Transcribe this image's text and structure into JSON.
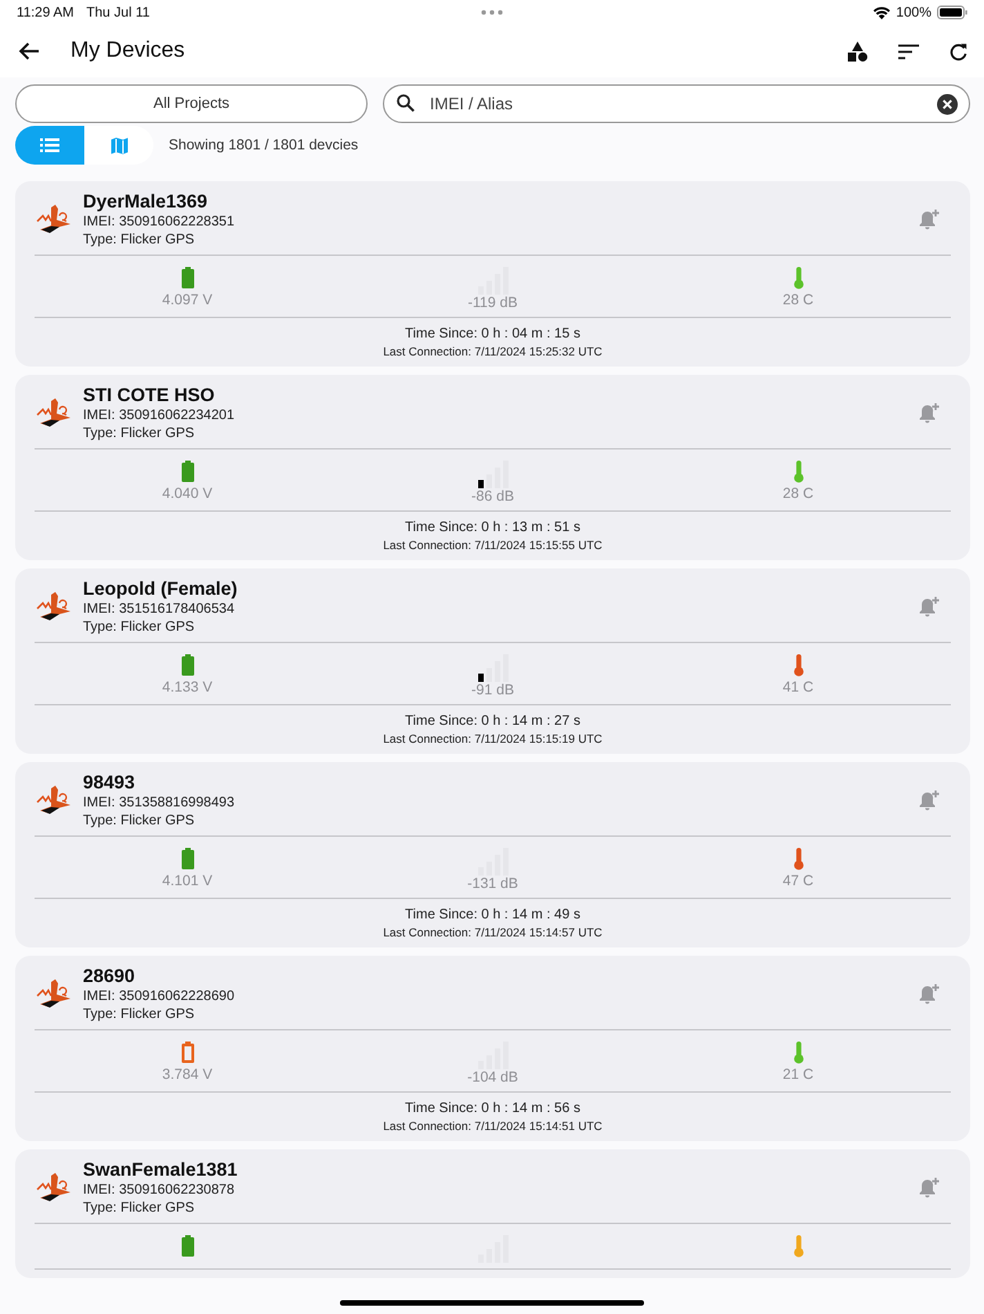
{
  "status_bar": {
    "time": "11:29 AM",
    "date": "Thu Jul 11",
    "battery": "100%"
  },
  "header": {
    "title": "My Devices"
  },
  "filters": {
    "project": "All Projects",
    "search": {
      "placeholder": "IMEI / Alias"
    }
  },
  "view_toggle": [
    {
      "kind": "list",
      "selected": true
    },
    {
      "kind": "map",
      "selected": false
    }
  ],
  "count": "Showing 1801 / 1801 devcies",
  "devices": [
    {
      "name": "DyerMale1369",
      "imei": "IMEI: 350916062228351",
      "type": "Type: Flicker GPS",
      "battery": {
        "reading": "4.097 V",
        "color": "#3a9a1e"
      },
      "signal": {
        "reading": "-119 dB",
        "first_bar_lit": false
      },
      "temperature": {
        "reading": "28 C",
        "color": "#5cc22a"
      },
      "time_since": "Time Since: 0 h : 04 m : 15 s",
      "last_connection": "Last Connection: 7/11/2024 15:25:32 UTC"
    },
    {
      "name": "STI COTE HSO",
      "imei": "IMEI: 350916062234201",
      "type": "Type: Flicker GPS",
      "battery": {
        "reading": "4.040 V",
        "color": "#3a9a1e"
      },
      "signal": {
        "reading": "-86 dB",
        "first_bar_lit": true
      },
      "temperature": {
        "reading": "28 C",
        "color": "#5cc22a"
      },
      "time_since": "Time Since: 0 h : 13 m : 51 s",
      "last_connection": "Last Connection: 7/11/2024 15:15:55 UTC"
    },
    {
      "name": "Leopold (Female)",
      "imei": "IMEI: 351516178406534",
      "type": "Type: Flicker GPS",
      "battery": {
        "reading": "4.133 V",
        "color": "#3a9a1e"
      },
      "signal": {
        "reading": "-91 dB",
        "first_bar_lit": true
      },
      "temperature": {
        "reading": "41 C",
        "color": "#e0521c"
      },
      "time_since": "Time Since: 0 h : 14 m : 27 s",
      "last_connection": "Last Connection: 7/11/2024 15:15:19 UTC"
    },
    {
      "name": "98493",
      "imei": "IMEI: 351358816998493",
      "type": "Type: Flicker GPS",
      "battery": {
        "reading": "4.101 V",
        "color": "#3a9a1e"
      },
      "signal": {
        "reading": "-131 dB",
        "first_bar_lit": false
      },
      "temperature": {
        "reading": "47 C",
        "color": "#e0521c"
      },
      "time_since": "Time Since: 0 h : 14 m : 49 s",
      "last_connection": "Last Connection: 7/11/2024 15:14:57 UTC"
    },
    {
      "name": "28690",
      "imei": "IMEI: 350916062228690",
      "type": "Type: Flicker GPS",
      "battery": {
        "reading": "3.784 V",
        "color": "#e8641e"
      },
      "signal": {
        "reading": "-104 dB",
        "first_bar_lit": false
      },
      "temperature": {
        "reading": "21 C",
        "color": "#5cc22a"
      },
      "time_since": "Time Since: 0 h : 14 m : 56 s",
      "last_connection": "Last Connection: 7/11/2024 15:14:51 UTC"
    },
    {
      "name": "SwanFemale1381",
      "imei": "IMEI: 350916062230878",
      "type": "Type: Flicker GPS",
      "battery": {
        "color": "#3a9a1e"
      },
      "signal": {
        "first_bar_lit": false
      },
      "temperature": {
        "color": "#f0a81e"
      }
    }
  ]
}
